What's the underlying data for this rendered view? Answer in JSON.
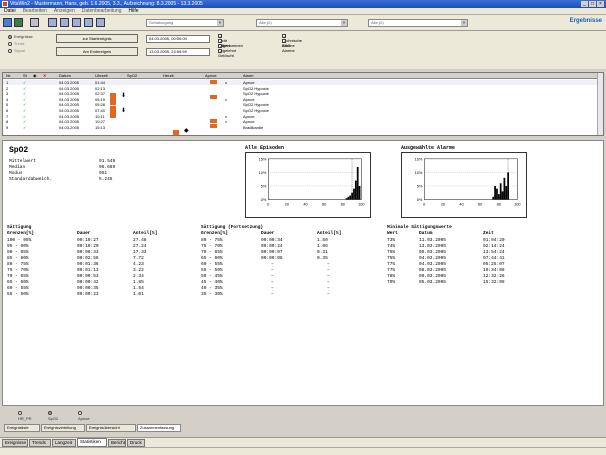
{
  "window": {
    "title": "VitaWin2 - Mustermann, Hans, geb. 1.6.2005, 3.3., Aufzeichnung: 8.3.2005 - 13.3.2005",
    "min": "_",
    "max": "□",
    "close": "×"
  },
  "menu": [
    "Datei",
    "Bearbeiten",
    "Anzeigen",
    "Datenbearbeitung",
    "Hilfe"
  ],
  "toolbar": {
    "combo1": "Schlafzugang",
    "combo2": "Alle (0)",
    "combo3": "Alle (0)",
    "brand": "Ergebnisse"
  },
  "filter": {
    "r1": "Ereignisse",
    "r2": "Trend",
    "r3": "Signal",
    "btn_beginning": "zur Startereignis",
    "btn_end": "Am Endereignis",
    "date_from": "04.03.2005, 00:00:00",
    "date_to": "13.03.2005, 23:59:59",
    "chk": [
      {
        "label": "Nicht editiert",
        "on": true
      },
      {
        "label": "Angenommen",
        "on": true
      },
      {
        "label": "Abgelehnt",
        "on": true
      },
      {
        "label": "Gelöscht",
        "on": true
      }
    ],
    "chk2": [
      {
        "label": "Technische Alarme",
        "on": true
      },
      {
        "label": "EKG Alarme",
        "on": true
      }
    ]
  },
  "grid": {
    "headers": [
      "Nr.",
      "St",
      "",
      "",
      "Datum",
      "Uhrzeit",
      "SpO2",
      "Herzfr.",
      "Apnoe",
      "Alarm"
    ],
    "rows": [
      {
        "nr": "1",
        "st": "✓",
        "date": "04.03.2005",
        "time": "01:44",
        "alarm": "Apnoe"
      },
      {
        "nr": "2",
        "st": "✓",
        "date": "04.03.2005",
        "time": "02:13",
        "alarm": "SpO2 Hypoxie"
      },
      {
        "nr": "3",
        "st": "✓",
        "date": "04.03.2005",
        "time": "02:37",
        "alarm": "SpO2 Hypoxie"
      },
      {
        "nr": "4",
        "st": "✓",
        "date": "04.03.2005",
        "time": "05:19",
        "alarm": "Apnoe"
      },
      {
        "nr": "5",
        "st": "✓",
        "date": "04.03.2005",
        "time": "05:28",
        "alarm": "SpO2 Hypoxie"
      },
      {
        "nr": "6",
        "st": "✓",
        "date": "04.03.2005",
        "time": "07:40",
        "alarm": "SpO2 Hypoxie"
      },
      {
        "nr": "7",
        "st": "✓",
        "date": "04.03.2005",
        "time": "10:11",
        "alarm": "Apnoe"
      },
      {
        "nr": "8",
        "st": "✓",
        "date": "04.03.2005",
        "time": "10:27",
        "alarm": "Apnoe"
      },
      {
        "nr": "9",
        "st": "✓",
        "date": "04.03.2005",
        "time": "15:13",
        "alarm": "Bradikardie"
      }
    ]
  },
  "panel": {
    "title": "SpO2",
    "stats": [
      {
        "label": "Mittelwert",
        "value": "91.549"
      },
      {
        "label": "Median",
        "value": "96.669"
      },
      {
        "label": "Modus",
        "value": "951"
      },
      {
        "label": "Standardabweich.",
        "value": "5.245"
      }
    ],
    "chart_titles": [
      "Alle Episoden",
      "Ausgewählte Alarme"
    ]
  },
  "chart_data": [
    {
      "type": "bar",
      "title": "Alle Episoden",
      "y_ticks": [
        "15%",
        "10%",
        "5%",
        "0%"
      ],
      "x_ticks": [
        "0",
        "20",
        "40",
        "60",
        "80",
        "100"
      ],
      "xlim": [
        0,
        100
      ],
      "ylim": [
        0,
        15
      ],
      "x": [
        84,
        86,
        88,
        90,
        92,
        94,
        96,
        98
      ],
      "values": [
        0.5,
        1,
        1.5,
        2.5,
        4,
        7,
        12,
        5
      ]
    },
    {
      "type": "bar",
      "title": "Ausgewählte Alarme",
      "y_ticks": [
        "15%",
        "10%",
        "5%",
        "0%"
      ],
      "x_ticks": [
        "0",
        "20",
        "40",
        "60",
        "80",
        "100"
      ],
      "xlim": [
        0,
        100
      ],
      "ylim": [
        0,
        15
      ],
      "x": [
        74,
        76,
        78,
        80,
        82,
        84,
        86,
        88,
        90
      ],
      "values": [
        1,
        5,
        4,
        2,
        6,
        3,
        8,
        5,
        10
      ]
    }
  ],
  "tables": {
    "t1": {
      "title": "Sättigung",
      "headers": [
        "Grenzen[%]",
        "Dauer",
        "Anteil[%]"
      ],
      "rows": [
        [
          "100 - 95%",
          "00:10:27",
          "27.48"
        ],
        [
          "95 - 90%",
          "00:10:20",
          "27.24"
        ],
        [
          "90 - 85%",
          "00:06:33",
          "17.33"
        ],
        [
          "85 - 80%",
          "00:02:56",
          "7.72"
        ],
        [
          "80 - 75%",
          "00:01:36",
          "4.23"
        ],
        [
          "75 - 70%",
          "00:01:13",
          "3.22"
        ],
        [
          "70 - 65%",
          "00:00:53",
          "2.34"
        ],
        [
          "65 - 60%",
          "00:00:42",
          "1.85"
        ],
        [
          "60 - 55%",
          "00:00:35",
          "1.54"
        ],
        [
          "55 - 50%",
          "00:00:23",
          "1.01"
        ]
      ]
    },
    "t2": {
      "title": "Sättigung (Fortsetzung)",
      "headers": [
        "Grenzen[%]",
        "Dauer",
        "Anteil[%]"
      ],
      "rows": [
        [
          "80 - 75%",
          "00:00:34",
          "1.50"
        ],
        [
          "75 - 70%",
          "00:00:24",
          "1.06"
        ],
        [
          "70 - 65%",
          "00:00:07",
          "0.31"
        ],
        [
          "65 - 60%",
          "00:00:08",
          "0.35"
        ],
        [
          "60 - 55%",
          "–",
          "–"
        ],
        [
          "55 - 50%",
          "–",
          "–"
        ],
        [
          "50 - 45%",
          "–",
          "–"
        ],
        [
          "45 - 40%",
          "–",
          "–"
        ],
        [
          "40 - 35%",
          "–",
          "–"
        ],
        [
          "35 - 30%",
          "–",
          "–"
        ]
      ]
    },
    "t3": {
      "title": "Minimale Sättigungswerte",
      "headers": [
        "Wert",
        "Datum",
        "Zeit"
      ],
      "rows": [
        [
          "73%",
          "11.03.2005",
          "01:04:20"
        ],
        [
          "74%",
          "13.03.2005",
          "02:14:24"
        ],
        [
          "75%",
          "05.03.2005",
          "13:54:24"
        ],
        [
          "75%",
          "04.03.2005",
          "07:44:41"
        ],
        [
          "77%",
          "04.03.2005",
          "05:25:07"
        ],
        [
          "77%",
          "08.03.2005",
          "19:34:08"
        ],
        [
          "78%",
          "09.03.2005",
          "12:32:26"
        ],
        [
          "79%",
          "05.03.2005",
          "15:32:08"
        ]
      ]
    }
  },
  "bottom_radio": [
    {
      "label": "HR_PR",
      "on": false
    },
    {
      "label": "SpO2",
      "on": true
    },
    {
      "label": "Apnoe",
      "on": false
    }
  ],
  "tabs1": [
    "Ereignisliste",
    "Ereignisverteilung",
    "Ereignisübersicht",
    "Zusammenfassung"
  ],
  "tabs2": [
    "Ereignisse",
    "Trends",
    "Langzeit",
    "Statistiken",
    "Bericht",
    "Druck"
  ]
}
